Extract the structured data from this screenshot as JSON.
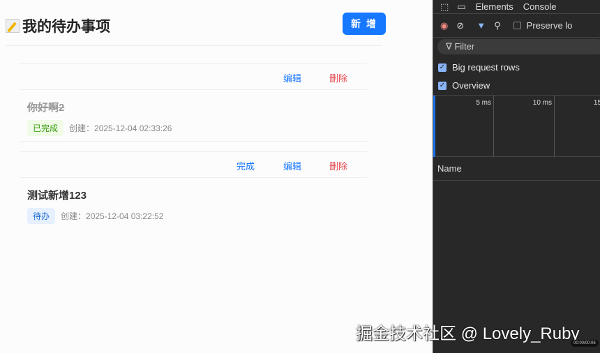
{
  "app": {
    "title": "我的待办事项",
    "add_label": "新 增",
    "todos": [
      {
        "name": "你好啊2",
        "status": "已完成",
        "created": "创建：2025-12-04 02:33:26",
        "actions": {
          "edit": "编辑",
          "delete": "删除"
        }
      },
      {
        "name": "测试新增123",
        "status": "待办",
        "created": "创建：2025-12-04 03:22:52",
        "actions": {
          "complete": "完成",
          "edit": "编辑",
          "delete": "删除"
        }
      }
    ]
  },
  "devtools": {
    "tabs": [
      "Elements",
      "Console"
    ],
    "preserve_log": "Preserve lo",
    "filter_placeholder": "Filter",
    "checkboxes": [
      "Big request rows",
      "Overview"
    ],
    "ticks": [
      "5 ms",
      "10 ms",
      "15"
    ],
    "name_header": "Name"
  },
  "watermark": "掘金技术社区 @ Lovely_Ruby",
  "video_time": "00:00/00:06"
}
